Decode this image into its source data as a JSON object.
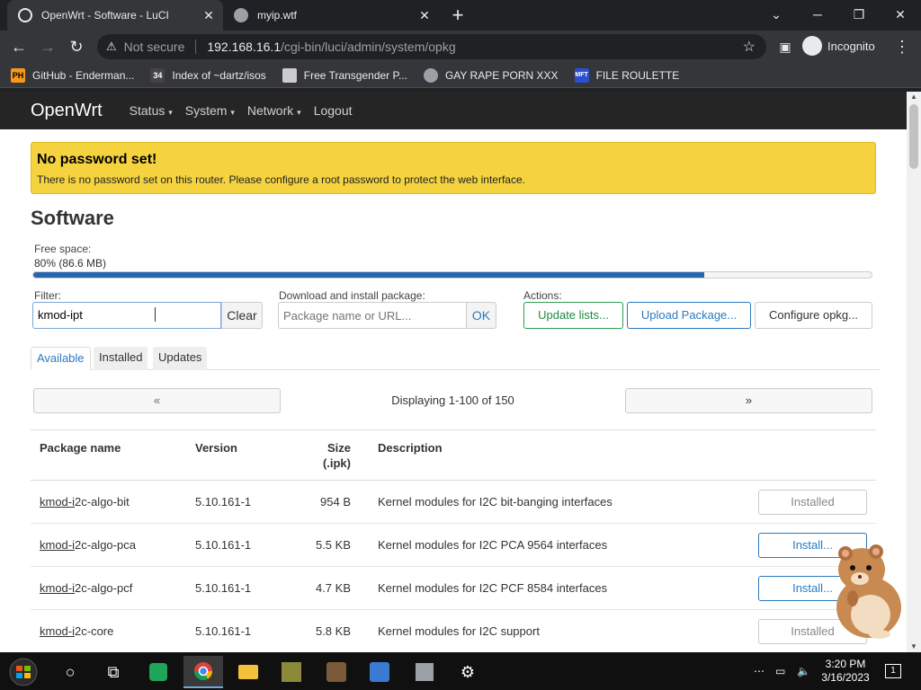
{
  "browser": {
    "tabs": [
      {
        "title": "OpenWrt - Software - LuCI",
        "active": true
      },
      {
        "title": "myip.wtf",
        "active": false
      }
    ],
    "omnibox": {
      "security_label": "Not secure",
      "host": "192.168.16.1",
      "path": "/cgi-bin/luci/admin/system/opkg"
    },
    "profile_label": "Incognito",
    "bookmarks": [
      {
        "label": "GitHub - Enderman...",
        "icon": "PH",
        "color": "#f7971d"
      },
      {
        "label": "Index of ~dartz/isos",
        "icon": "34",
        "color": "#444444"
      },
      {
        "label": "Free Transgender P...",
        "icon": "mask",
        "color": "#cccccc"
      },
      {
        "label": "GAY RAPE PORN XXX",
        "icon": "globe",
        "color": "#9aa0a6"
      },
      {
        "label": "FILE ROULETTE",
        "icon": "MFT",
        "color": "#2c4ed0"
      }
    ]
  },
  "luci": {
    "brand": "OpenWrt",
    "menu": [
      "Status",
      "System",
      "Network",
      "Logout"
    ],
    "alert": {
      "title": "No password set!",
      "text": "There is no password set on this router. Please configure a root password to protect the web interface."
    },
    "title": "Software",
    "free_space": {
      "label": "Free space:",
      "value": "80% (86.6 MB)",
      "fraction": 0.8
    },
    "filter": {
      "label": "Filter:",
      "value": "kmod-ipt",
      "clear_label": "Clear"
    },
    "download": {
      "label": "Download and install package:",
      "placeholder": "Package name or URL...",
      "ok_label": "OK"
    },
    "actions": {
      "label": "Actions:",
      "update_lists": "Update lists...",
      "upload_package": "Upload Package...",
      "configure_opkg": "Configure opkg..."
    },
    "tabs": [
      "Available",
      "Installed",
      "Updates"
    ],
    "pager": {
      "prev": "«",
      "next": "»",
      "text": "Displaying 1-100 of 150"
    },
    "table": {
      "headers": {
        "name": "Package name",
        "version": "Version",
        "size_line1": "Size",
        "size_line2": "(.ipk)",
        "description": "Description"
      },
      "rows": [
        {
          "name_prefix": "kmod-i",
          "name_rest": "2c-algo-bit",
          "version": "5.10.161-1",
          "size": "954 B",
          "description": "Kernel modules for I2C bit-banging interfaces",
          "action": "Installed"
        },
        {
          "name_prefix": "kmod-i",
          "name_rest": "2c-algo-pca",
          "version": "5.10.161-1",
          "size": "5.5 KB",
          "description": "Kernel modules for I2C PCA 9564 interfaces",
          "action": "Install..."
        },
        {
          "name_prefix": "kmod-i",
          "name_rest": "2c-algo-pcf",
          "version": "5.10.161-1",
          "size": "4.7 KB",
          "description": "Kernel modules for I2C PCF 8584 interfaces",
          "action": "Install..."
        },
        {
          "name_prefix": "kmod-i",
          "name_rest": "2c-core",
          "version": "5.10.161-1",
          "size": "5.8 KB",
          "description": "Kernel modules for I2C support",
          "action": "Installed"
        }
      ]
    }
  },
  "taskbar": {
    "clock_time": "3:20 PM",
    "clock_date": "3/16/2023",
    "notification_count": "1"
  }
}
